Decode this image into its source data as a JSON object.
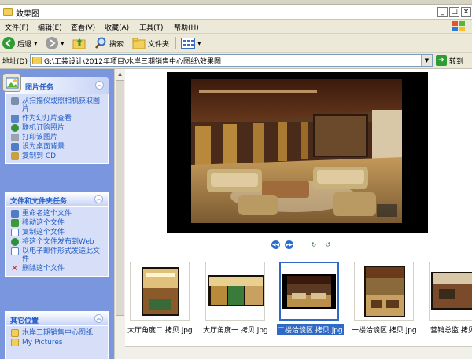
{
  "window": {
    "title": "效果图"
  },
  "menu": [
    "文件(F)",
    "编辑(E)",
    "查看(V)",
    "收藏(A)",
    "工具(T)",
    "帮助(H)"
  ],
  "toolbar": {
    "back": "后退",
    "search": "搜索",
    "folders": "文件夹"
  },
  "address": {
    "label": "地址(D)",
    "path": "G:\\工装设计\\2012年项目\\水岸三期销售中心图纸\\效果图",
    "go": "转到"
  },
  "tasks": {
    "picture": {
      "title": "图片任务",
      "items": [
        "从扫描仪或照相机获取图片",
        "作为幻灯片查看",
        "联机订购照片",
        "打印该图片",
        "设为桌面背景",
        "复制到 CD"
      ]
    },
    "file": {
      "title": "文件和文件夹任务",
      "items": [
        "重命名这个文件",
        "移动这个文件",
        "复制这个文件",
        "将这个文件发布到Web",
        "以电子邮件形式发送此文件",
        "删除这个文件"
      ]
    },
    "other": {
      "title": "其它位置",
      "items": [
        "水岸三期销售中心图纸",
        "My Pictures"
      ]
    }
  },
  "thumbnails": [
    {
      "label": "大厅角度二 拷贝.jpg",
      "selected": false
    },
    {
      "label": "大厅角度一 拷贝.jpg",
      "selected": false
    },
    {
      "label": "二楼洽谈区 拷贝.jpg",
      "selected": true
    },
    {
      "label": "一楼洽谈区 拷贝.jpg",
      "selected": false
    },
    {
      "label": "营销总监 拷贝.jpg",
      "selected": false
    }
  ],
  "colors": {
    "accent": "#316ac5",
    "panel_bg": "#7a96df",
    "link": "#215dc6"
  }
}
